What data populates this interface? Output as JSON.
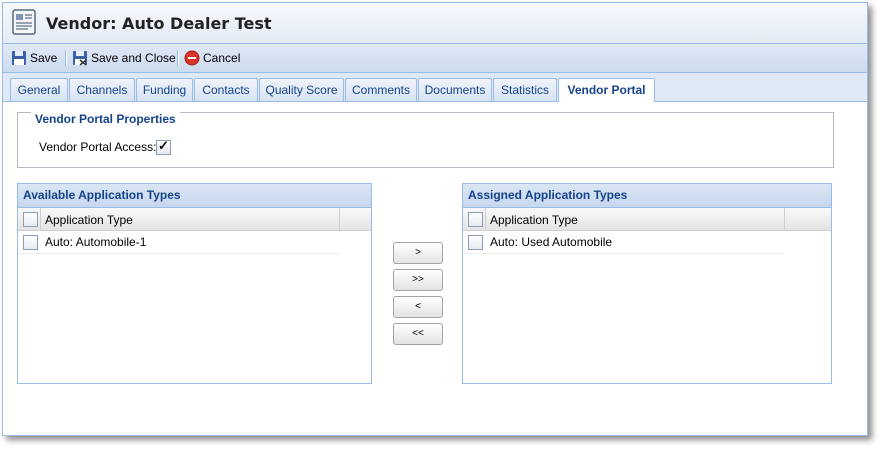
{
  "window": {
    "title": "Vendor: Auto Dealer Test"
  },
  "toolbar": {
    "save_label": "Save",
    "save_close_label": "Save and Close",
    "cancel_label": "Cancel"
  },
  "tabs": [
    {
      "label": "General"
    },
    {
      "label": "Channels"
    },
    {
      "label": "Funding"
    },
    {
      "label": "Contacts"
    },
    {
      "label": "Quality Score"
    },
    {
      "label": "Comments"
    },
    {
      "label": "Documents"
    },
    {
      "label": "Statistics"
    },
    {
      "label": "Vendor Portal",
      "active": true
    }
  ],
  "properties": {
    "legend": "Vendor Portal Properties",
    "access_label": "Vendor Portal Access:",
    "access_checked": true
  },
  "available": {
    "title": "Available Application Types",
    "column": "Application Type",
    "rows": [
      "Auto: Automobile-1"
    ]
  },
  "assigned": {
    "title": "Assigned Application Types",
    "column": "Application Type",
    "rows": [
      "Auto: Used Automobile"
    ]
  },
  "move_buttons": {
    "add_one": ">",
    "add_all": ">>",
    "remove_one": "<",
    "remove_all": "<<"
  },
  "icons": {
    "save": "floppy-disk-icon",
    "save_close": "floppy-disk-close-icon",
    "cancel": "cancel-circle-icon",
    "window": "vendor-document-icon"
  },
  "colors": {
    "header_text": "#15428b",
    "border": "#99bbe8",
    "cancel": "#d9342b"
  }
}
